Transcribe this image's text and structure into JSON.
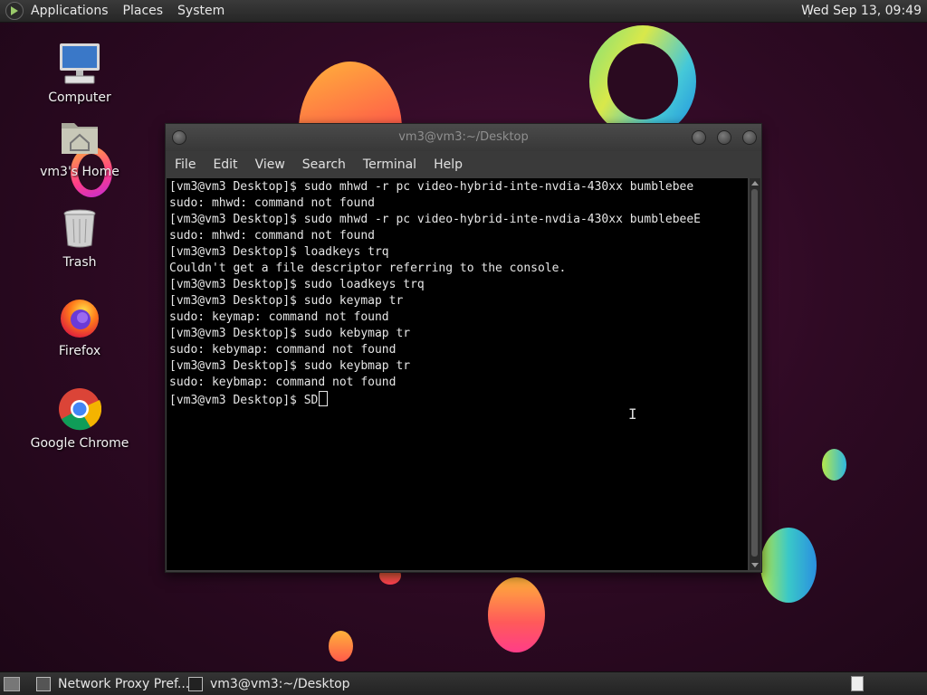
{
  "top_panel": {
    "menus": [
      "Applications",
      "Places",
      "System"
    ],
    "clock": "Wed Sep 13, 09:49"
  },
  "desktop": {
    "icons": [
      {
        "label": "Computer",
        "icon": "computer-icon"
      },
      {
        "label": "vm3's Home",
        "icon": "home-folder-icon"
      },
      {
        "label": "Trash",
        "icon": "trash-icon"
      },
      {
        "label": "Firefox",
        "icon": "firefox-icon"
      },
      {
        "label": "Google Chrome",
        "icon": "chrome-icon"
      }
    ]
  },
  "terminal": {
    "title": "vm3@vm3:~/Desktop",
    "menu": [
      "File",
      "Edit",
      "View",
      "Search",
      "Terminal",
      "Help"
    ],
    "lines": [
      "[vm3@vm3 Desktop]$ sudo mhwd -r pc video-hybrid-inte-nvdia-430xx bumblebee",
      "sudo: mhwd: command not found",
      "[vm3@vm3 Desktop]$ sudo mhwd -r pc video-hybrid-inte-nvdia-430xx bumblebeeE",
      "sudo: mhwd: command not found",
      "[vm3@vm3 Desktop]$ loadkeys trq",
      "Couldn't get a file descriptor referring to the console.",
      "[vm3@vm3 Desktop]$ sudo loadkeys trq",
      "[vm3@vm3 Desktop]$ sudo keymap tr",
      "sudo: keymap: command not found",
      "[vm3@vm3 Desktop]$ sudo kebymap tr",
      "sudo: kebymap: command not found",
      "[vm3@vm3 Desktop]$ sudo keybmap tr",
      "sudo: keybmap: command not found"
    ],
    "prompt": "[vm3@vm3 Desktop]$ ",
    "current_input": "SD"
  },
  "taskbar": {
    "tasks": [
      {
        "label": "Network Proxy Pref...",
        "icon": "network-proxy-icon"
      },
      {
        "label": "vm3@vm3:~/Desktop",
        "icon": "terminal-icon"
      }
    ]
  }
}
